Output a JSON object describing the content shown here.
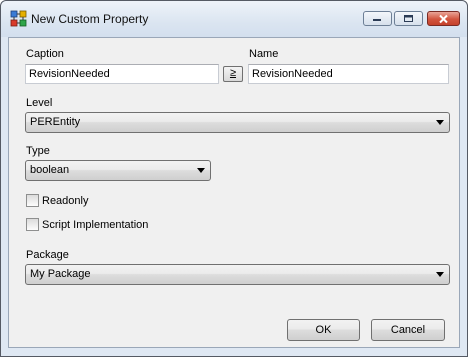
{
  "window": {
    "title": "New Custom Property",
    "app_icon": "custom-property-icon",
    "controls": [
      "minimize-icon",
      "maximize-icon",
      "close-icon"
    ]
  },
  "form": {
    "caption": {
      "label": "Caption",
      "value": "RevisionNeeded"
    },
    "copy_button": {
      "label": "≥"
    },
    "name": {
      "label": "Name",
      "value": "RevisionNeeded"
    },
    "level": {
      "label": "Level",
      "selected": "PEREntity"
    },
    "type": {
      "label": "Type",
      "selected": "boolean"
    },
    "readonly": {
      "label": "Readonly",
      "checked": false
    },
    "script_impl": {
      "label": "Script Implementation",
      "checked": false
    },
    "package": {
      "label": "Package",
      "selected": "My Package"
    }
  },
  "buttons": {
    "ok": "OK",
    "cancel": "Cancel"
  }
}
